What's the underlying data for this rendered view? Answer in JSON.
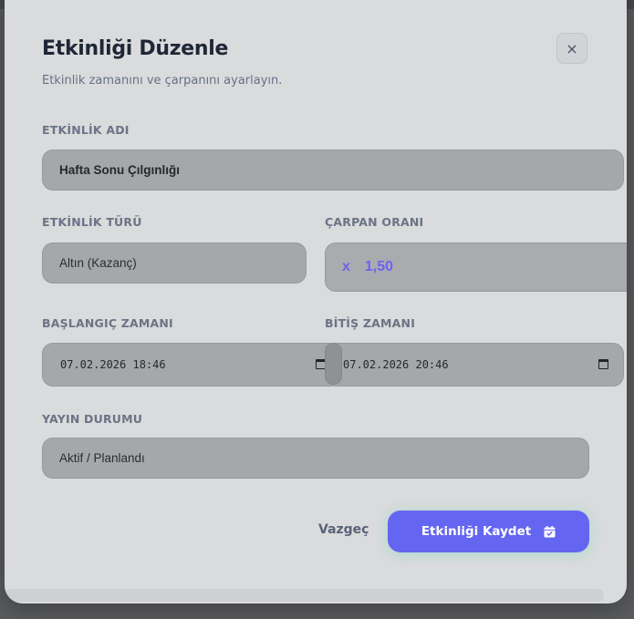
{
  "modal": {
    "title": "Etkinliği Düzenle",
    "subtitle": "Etkinlik zamanını ve çarpanını ayarlayın.",
    "close_label": "×"
  },
  "fields": {
    "name": {
      "label": "ETKİNLİK ADI",
      "value": "Hafta Sonu Çılgınlığı"
    },
    "type": {
      "label": "ETKİNLİK TÜRÜ",
      "value": "Altın (Kazanç)"
    },
    "multiplier": {
      "label": "ÇARPAN ORANI",
      "prefix": "x",
      "value": "1,50"
    },
    "start": {
      "label": "BAŞLANGIÇ ZAMANI",
      "value": "07.02.2026 18:46"
    },
    "end": {
      "label": "BİTİŞ ZAMANI",
      "value": "07.02.2026 20:46"
    },
    "status": {
      "label": "YAYIN DURUMU",
      "value": "Aktif / Planlandı"
    }
  },
  "actions": {
    "cancel_label": "Vazgeç",
    "save_label": "Etkinliği Kaydet"
  },
  "colors": {
    "accent": "#6466f1",
    "overlay": "#5c5d60",
    "modal_bg": "#dadbdc"
  },
  "icons": {
    "close": "close-icon",
    "calendar": "calendar-icon",
    "save": "calendar-check-icon"
  }
}
